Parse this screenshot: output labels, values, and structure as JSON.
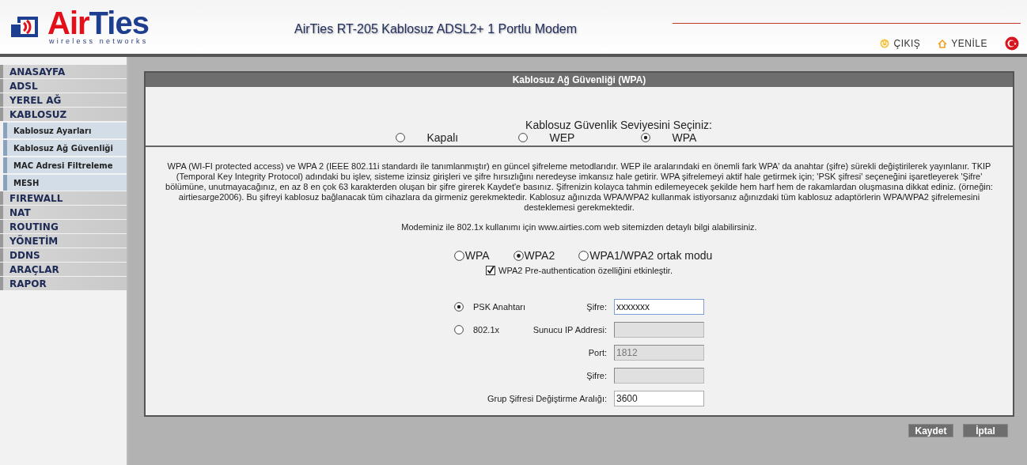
{
  "header": {
    "brand": [
      "Air",
      "Ties"
    ],
    "tagline": "wireless networks",
    "title": "AirTies RT-205 Kablosuz ADSL2+ 1 Portlu Modem",
    "links": [
      {
        "label": "ÇIKIŞ",
        "kind": "power"
      },
      {
        "label": "YENİLE",
        "kind": "home"
      }
    ]
  },
  "sidebar": {
    "items": [
      {
        "label": "ANASAYFA"
      },
      {
        "label": "ADSL"
      },
      {
        "label": "YEREL AĞ"
      },
      {
        "label": "KABLOSUZ",
        "children": [
          {
            "label": "Kablosuz Ayarları"
          },
          {
            "label": "Kablosuz Ağ Güvenliği"
          },
          {
            "label": "MAC Adresi Filtreleme"
          },
          {
            "label": "MESH"
          }
        ]
      },
      {
        "label": "FIREWALL"
      },
      {
        "label": "NAT"
      },
      {
        "label": "ROUTING"
      },
      {
        "label": "YÖNETİM"
      },
      {
        "label": "DDNS"
      },
      {
        "label": "ARAÇLAR"
      },
      {
        "label": "RAPOR"
      }
    ]
  },
  "panel": {
    "title": "Kablosuz Ağ Güvenliği (WPA)",
    "security_level": {
      "label": "Kablosuz Güvenlik Seviyesini Seçiniz:",
      "options": [
        {
          "label": "Kapalı",
          "selected": false
        },
        {
          "label": "WEP",
          "selected": false
        },
        {
          "label": "WPA",
          "selected": true
        }
      ]
    },
    "description": "WPA (WI-FI protected access) ve WPA 2 (IEEE 802.11i standardı ile tanımlanmıştır) en güncel şifreleme metodlarıdır. WEP ile aralarındaki en önemli fark WPA' da anahtar (şifre) sürekli değiştirilerek yayınlanır. TKIP (Temporal Key Integrity Protocol) adındaki bu işlev, sisteme izinsiz girişleri ve şifre hırsızlığını neredeyse imkansız hale getirir. WPA şifrelemeyi aktif hale getirmek için; 'PSK şifresi' seçeneğini işaretleyerek 'Şifre' bölümüne, unutmayacağınız, en az 8 en çok 63 karakterden oluşan bir şifre girerek Kaydet'e basınız. Şifrenizin kolayca tahmin edilemeyecek şekilde hem harf hem de rakamlardan oluşmasına dikkat ediniz. (örneğin: airtiesarge2006). Bu şifreyi kablosuz bağlanacak tüm cihazlara da girmeniz gerekmektedir. Kablosuz ağınızda WPA/WPA2 kullanmak istiyorsanız ağınızdaki tüm kablosuz adaptörlerin WPA/WPA2 şifrelemesini desteklemesi gerekmektedir.",
    "info": "Modeminiz ile 802.1x kullanımı için www.airties.com web sitemizden detaylı bilgi alabilirsiniz.",
    "wpa_modes": [
      {
        "label": "WPA",
        "selected": false
      },
      {
        "label": "WPA2",
        "selected": true
      },
      {
        "label": "WPA1/WPA2 ortak modu",
        "selected": false
      }
    ],
    "preauth": {
      "label": "WPA2 Pre-authentication özelliğini etkinleştir.",
      "checked": true
    },
    "auth_methods": [
      {
        "label": "PSK Anahtarı",
        "selected": true
      },
      {
        "label": "802.1x",
        "selected": false
      }
    ],
    "fields": [
      {
        "label": "Şifre:",
        "value": "xxxxxxx",
        "disabled": false,
        "focused": true
      },
      {
        "label": "Sunucu IP Addresi:",
        "disabled": true
      },
      {
        "label": "Port:",
        "value": "1812",
        "disabled": true
      },
      {
        "label": "Şifre:",
        "disabled": true
      },
      {
        "label": "Grup Şifresi Değiştirme Aralığı:",
        "value": "3600",
        "disabled": false
      }
    ]
  },
  "buttons": [
    "Kaydet",
    "İptal"
  ]
}
